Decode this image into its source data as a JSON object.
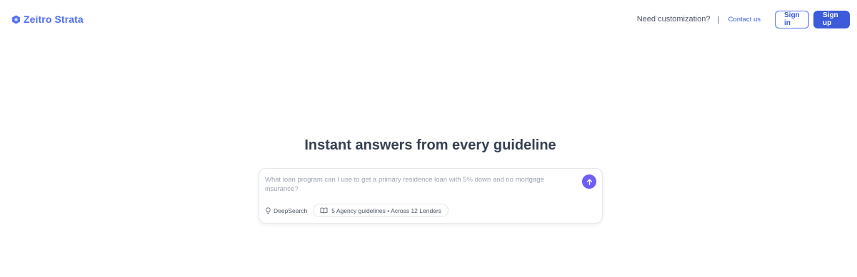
{
  "brand": {
    "name": "Zeitro Strata",
    "color": "#4f6df5",
    "icon": "hexagon-logo-icon"
  },
  "nav": {
    "question": "Need customization?",
    "separator": "|",
    "contact": "Contact us",
    "sign_in": "Sign in",
    "sign_up": "Sign up"
  },
  "hero": {
    "title": "Instant answers from every guideline"
  },
  "ask": {
    "placeholder": "What loan program can I use to get a primary residence loan with 5% down and no mortgage insurance?",
    "value": "",
    "send_icon": "arrow-up-icon",
    "deepsearch_label": "DeepSearch",
    "deepsearch_icon": "lightbulb-icon",
    "guidelines_label": "5 Agency guidelines • Across 12 Lenders",
    "guidelines_icon": "book-open-icon"
  },
  "colors": {
    "accent": "#3b5bdb",
    "send": "#6d5ef5",
    "title": "#374151"
  }
}
